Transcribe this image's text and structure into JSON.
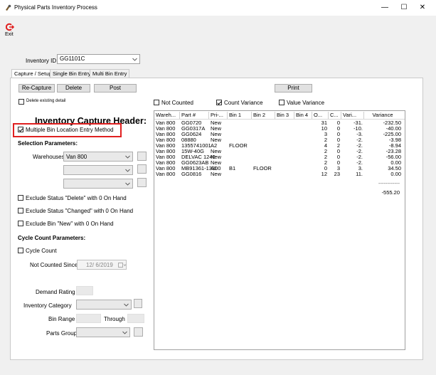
{
  "window": {
    "title": "Physical Parts Inventory Process",
    "minimize": "—",
    "maximize": "☐",
    "close": "✕"
  },
  "toolbar": {
    "exit_label": "Exit"
  },
  "inventory": {
    "label": "Inventory ID",
    "value": "GG1101C"
  },
  "tabs": [
    {
      "label": "Capture / Setup",
      "active": true
    },
    {
      "label": "Single Bin Entry",
      "active": false
    },
    {
      "label": "Multi Bin Entry",
      "active": false
    }
  ],
  "actions": {
    "recapture": "Re-Capture",
    "delete": "Delete",
    "post": "Post",
    "print": "Print"
  },
  "delete_existing": {
    "label": "Delete existing detail",
    "checked": false
  },
  "capture_header": "Inventory Capture Header:",
  "multi_bin": {
    "label": "Multiple Bin Location Entry Method",
    "checked": true
  },
  "selection": {
    "title": "Selection Parameters:",
    "warehouses_label": "Warehouses",
    "warehouse_value": "Van 800"
  },
  "excludes": [
    {
      "label": "Exclude Status \"Delete\" with 0 On Hand",
      "checked": false
    },
    {
      "label": "Exclude Status \"Changed\" with 0 On Hand",
      "checked": false
    },
    {
      "label": "Exclude Bin \"New\" with 0 On Hand",
      "checked": false
    }
  ],
  "cycle": {
    "title": "Cycle Count Parameters:",
    "cycle_count_label": "Cycle Count",
    "cycle_count_checked": false,
    "not_counted_since_label": "Not Counted Since",
    "not_counted_since_value": "12/ 6/2019"
  },
  "filters": {
    "demand_rating": "Demand Rating",
    "inventory_category": "Inventory Category",
    "bin_range": "Bin Range",
    "through": "Through",
    "parts_group": "Parts Group"
  },
  "grid_filters": {
    "not_counted": {
      "label": "Not Counted",
      "checked": false
    },
    "count_variance": {
      "label": "Count Variance",
      "checked": true
    },
    "value_variance": {
      "label": "Value Variance",
      "checked": false
    }
  },
  "grid": {
    "columns": [
      "Wareh...",
      "Part #",
      "Pri-...",
      "Bin 1",
      "Bin 2",
      "Bin 3",
      "Bin 4",
      "O...",
      "C...",
      "Vari...",
      "Variance"
    ],
    "rows": [
      [
        "Van 800",
        "GG0720",
        "New",
        "",
        "",
        "",
        "",
        "31",
        "0",
        "-31.",
        "-232.50"
      ],
      [
        "Van 800",
        "GG0317A",
        "New",
        "",
        "",
        "",
        "",
        "10",
        "0",
        "-10.",
        "-40.00"
      ],
      [
        "Van 800",
        "GG0624",
        "New",
        "",
        "",
        "",
        "",
        "3",
        "0",
        "-3.",
        "-225.00"
      ],
      [
        "Van 800",
        "08880",
        "New",
        "",
        "",
        "",
        "",
        "2",
        "0",
        "-2.",
        "-3.98"
      ],
      [
        "Van 800",
        "1355741001",
        "A2",
        "FLOOR",
        "",
        "",
        "",
        "4",
        "2",
        "-2.",
        "-8.94"
      ],
      [
        "Van 800",
        "15W-40G",
        "New",
        "",
        "",
        "",
        "",
        "2",
        "0",
        "-2.",
        "-23.28"
      ],
      [
        "Van 800",
        "DELVAC 1240",
        "New",
        "",
        "",
        "",
        "",
        "2",
        "0",
        "-2.",
        "-56.00"
      ],
      [
        "Van 800",
        "GG0623AB",
        "New",
        "",
        "",
        "",
        "",
        "2",
        "0",
        "-2.",
        "0.00"
      ],
      [
        "Van 800",
        "MB91361-13300",
        "A1",
        "B1",
        "FLOOR",
        "",
        "",
        "0",
        "3",
        "3.",
        "34.50"
      ],
      [
        "Van 800",
        "GG0816",
        "New",
        "",
        "",
        "",
        "",
        "12",
        "23",
        "11.",
        "0.00"
      ]
    ],
    "total_rule": "------------",
    "total": "-555.20"
  }
}
